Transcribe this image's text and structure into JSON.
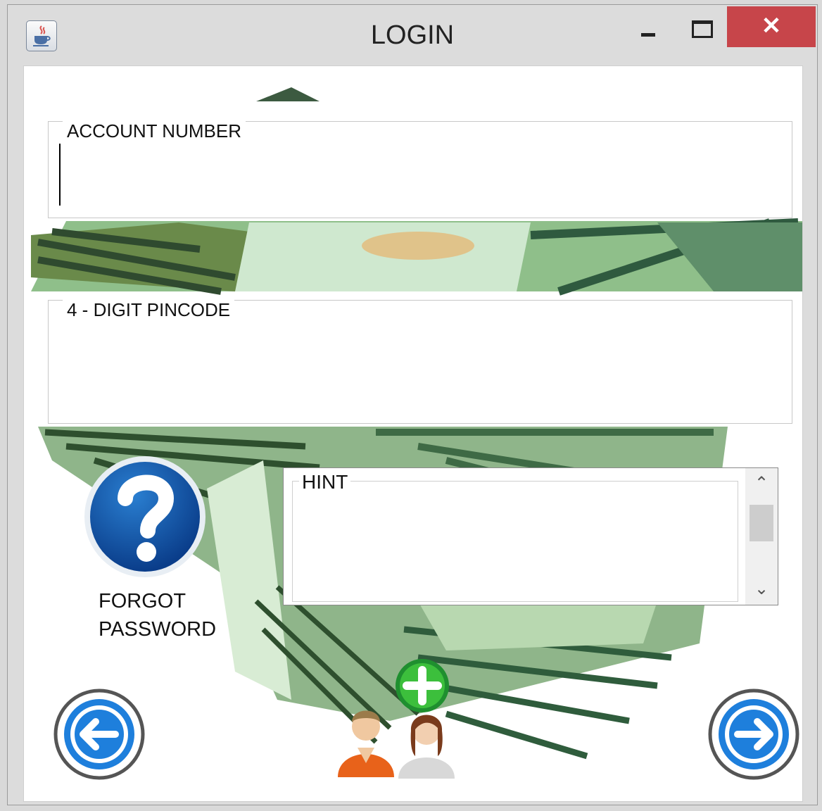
{
  "window": {
    "title": "LOGIN",
    "close_glyph": "✕"
  },
  "form": {
    "account_label": "ACCOUNT NUMBER",
    "account_value": "",
    "pin_label": "4 - DIGIT PINCODE",
    "pin_value": ""
  },
  "forgot": {
    "line1": "FORGOT",
    "line2": "PASSWORD"
  },
  "hint": {
    "label": "HINT",
    "text": ""
  },
  "scroll": {
    "up_glyph": "⌃",
    "down_glyph": "⌄"
  },
  "icons": {
    "app": "java-cup-icon",
    "help": "question-mark-icon",
    "back": "arrow-left-icon",
    "next": "arrow-right-icon",
    "add_user": "add-user-icon"
  },
  "colors": {
    "close": "#c7454a",
    "accent_blue": "#1e7fdc",
    "money_green": "#7aa36f"
  }
}
